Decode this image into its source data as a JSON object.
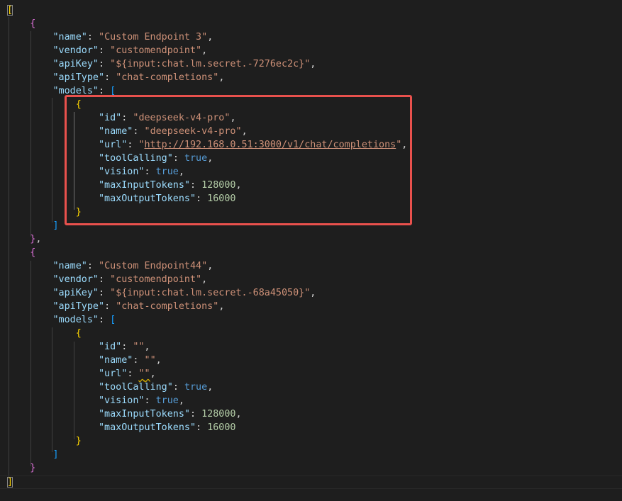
{
  "editor": {
    "top_partial": "    ",
    "endpoints": [
      {
        "name": "Custom Endpoint 3",
        "vendor": "customendpoint",
        "apiKey": "${input:chat.lm.secret.-7276ec2c}",
        "apiType": "chat-completions",
        "model": {
          "id": "deepseek-v4-pro",
          "name": "deepseek-v4-pro",
          "url": "http://192.168.0.51:3000/v1/chat/completions",
          "toolCalling": "true",
          "vision": "true",
          "maxInputTokens": "128000",
          "maxOutputTokens": "16000"
        }
      },
      {
        "name": "Custom Endpoint44",
        "vendor": "customendpoint",
        "apiKey": "${input:chat.lm.secret.-68a45050}",
        "apiType": "chat-completions",
        "model": {
          "id": "",
          "name": "",
          "url": "",
          "toolCalling": "true",
          "vision": "true",
          "maxInputTokens": "128000",
          "maxOutputTokens": "16000"
        }
      }
    ]
  },
  "colors": {
    "background": "#1e1e1e",
    "json_key": "#9cdcfe",
    "json_string": "#ce9178",
    "json_number": "#b5cea8",
    "json_keyword": "#569cd6",
    "highlight_box": "#e9514d"
  }
}
